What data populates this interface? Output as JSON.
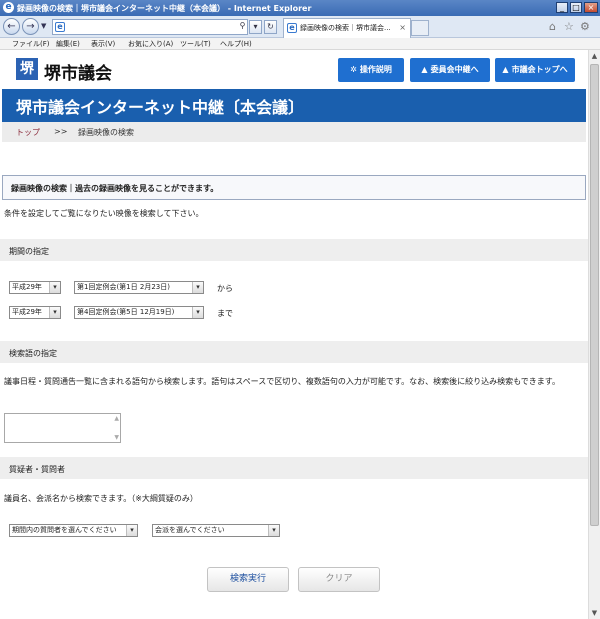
{
  "window": {
    "title": "録画映像の検索｜堺市議会インターネット中継（本会議） - Internet Explorer"
  },
  "browser": {
    "tab_title": "録画映像の検索｜堺市議会...",
    "menu": [
      "ファイル(F)",
      "編集(E)",
      "表示(V)",
      "お気に入り(A)",
      "ツール(T)",
      "ヘルプ(H)"
    ]
  },
  "site": {
    "logo_text": "堺市議会",
    "header_buttons": [
      {
        "label": "操作説明",
        "icon": "gear-icon"
      },
      {
        "label": "委員会中継へ",
        "icon": "triangle-icon"
      },
      {
        "label": "市議会トップへ",
        "icon": "triangle-icon"
      }
    ],
    "banner_title": "堺市議会インターネット中継〔本会議〕"
  },
  "breadcrumb": {
    "home": "トップ",
    "separator": ">>",
    "current": "録画映像の検索"
  },
  "page": {
    "info_heading": "録画映像の検索｜過去の録画映像を見ることができます。",
    "intro": "条件を設定してご覧になりたい映像を検索して下さい。",
    "period": {
      "heading": "期間の指定",
      "from_year": "平成29年",
      "from_session": "第1回定例会(第1日 2月23日)",
      "from_suffix": "から",
      "to_year": "平成29年",
      "to_session": "第4回定例会(第5日 12月19日)",
      "to_suffix": "まで"
    },
    "keyword": {
      "heading": "検索語の指定",
      "description": "議事日程・質問通告一覧に含まれる語句から検索します。語句はスペースで区切り、複数語句の入力が可能です。なお、検索後に絞り込み検索もできます。",
      "value": ""
    },
    "speaker": {
      "heading": "質疑者・質問者",
      "description": "議員名、会派名から検索できます。（※大綱質疑のみ）",
      "member_select": "期間内の質問者を選んでください",
      "party_select": "会派を選んでください"
    },
    "actions": {
      "search": "検索実行",
      "clear": "クリア"
    }
  },
  "colors": {
    "banner": "#1a5fae",
    "header_button": "#1f6fd0",
    "breadcrumb_home": "#8a2a3a"
  }
}
